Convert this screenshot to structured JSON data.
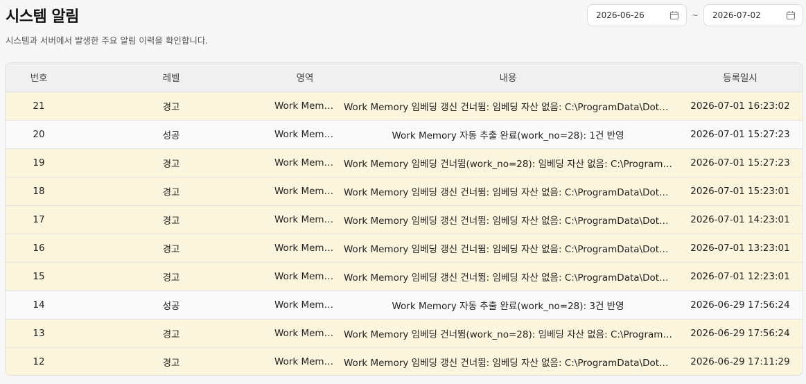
{
  "page": {
    "title": "시스템 알림",
    "subtitle": "시스템과 서버에서 발생한 주요 알림 이력을 확인합니다."
  },
  "date_range": {
    "from": "2026-06-26",
    "separator": "~",
    "to": "2026-07-02",
    "icon": "calendar-icon"
  },
  "table": {
    "headers": [
      "번호",
      "레벨",
      "영역",
      "내용",
      "등록일시"
    ],
    "rows": [
      {
        "no": "21",
        "level": "경고",
        "area": "Work Memory",
        "content": "Work Memory 임베딩 갱신 건너뜀: 임베딩 자산 없음: C:\\ProgramData\\Dotor...",
        "date": "2026-07-01 16:23:02",
        "status": "warn"
      },
      {
        "no": "20",
        "level": "성공",
        "area": "Work Memory",
        "content": "Work Memory 자동 추출 완료(work_no=28): 1건 반영",
        "date": "2026-07-01 15:27:23",
        "status": "ok"
      },
      {
        "no": "19",
        "level": "경고",
        "area": "Work Memory",
        "content": "Work Memory 임베딩 건너뜀(work_no=28): 임베딩 자산 없음: C:\\ProgramD...",
        "date": "2026-07-01 15:27:23",
        "status": "warn"
      },
      {
        "no": "18",
        "level": "경고",
        "area": "Work Memory",
        "content": "Work Memory 임베딩 갱신 건너뜀: 임베딩 자산 없음: C:\\ProgramData\\Dotor...",
        "date": "2026-07-01 15:23:01",
        "status": "warn"
      },
      {
        "no": "17",
        "level": "경고",
        "area": "Work Memory",
        "content": "Work Memory 임베딩 갱신 건너뜀: 임베딩 자산 없음: C:\\ProgramData\\Dotor...",
        "date": "2026-07-01 14:23:01",
        "status": "warn"
      },
      {
        "no": "16",
        "level": "경고",
        "area": "Work Memory",
        "content": "Work Memory 임베딩 갱신 건너뜀: 임베딩 자산 없음: C:\\ProgramData\\Dotor...",
        "date": "2026-07-01 13:23:01",
        "status": "warn"
      },
      {
        "no": "15",
        "level": "경고",
        "area": "Work Memory",
        "content": "Work Memory 임베딩 갱신 건너뜀: 임베딩 자산 없음: C:\\ProgramData\\Dotor...",
        "date": "2026-07-01 12:23:01",
        "status": "warn"
      },
      {
        "no": "14",
        "level": "성공",
        "area": "Work Memory",
        "content": "Work Memory 자동 추출 완료(work_no=28): 3건 반영",
        "date": "2026-06-29 17:56:24",
        "status": "ok"
      },
      {
        "no": "13",
        "level": "경고",
        "area": "Work Memory",
        "content": "Work Memory 임베딩 건너뜀(work_no=28): 임베딩 자산 없음: C:\\ProgramD...",
        "date": "2026-06-29 17:56:24",
        "status": "warn"
      },
      {
        "no": "12",
        "level": "경고",
        "area": "Work Memory",
        "content": "Work Memory 임베딩 갱신 건너뜀: 임베딩 자산 없음: C:\\ProgramData\\Dotor...",
        "date": "2026-06-29 17:11:29",
        "status": "warn"
      }
    ]
  },
  "colors": {
    "warn_row": "#fcf5dd",
    "ok_row": "#fafafa",
    "header_bg": "#f0f0f0"
  }
}
